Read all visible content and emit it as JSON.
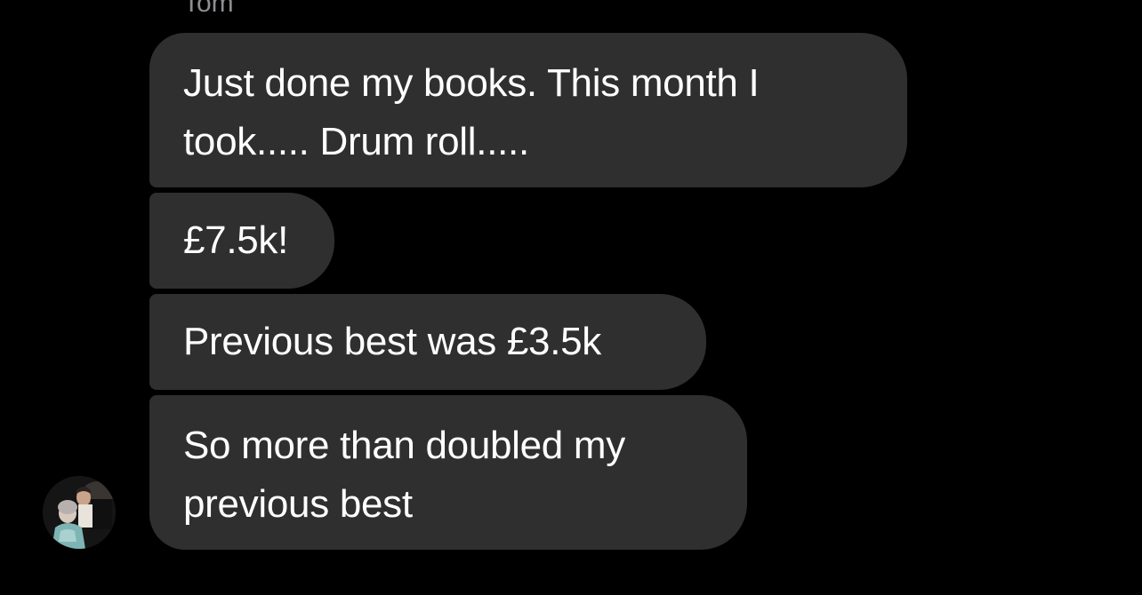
{
  "conversation": {
    "sender_name": "Tom",
    "messages": [
      {
        "lines": [
          "Just done my books. This month I",
          "took..... Drum roll....."
        ]
      },
      {
        "lines": [
          "£7.5k!"
        ]
      },
      {
        "lines": [
          "Previous best was £3.5k"
        ]
      },
      {
        "lines": [
          "So more than doubled my",
          "previous best"
        ]
      }
    ]
  },
  "colors": {
    "background": "#000000",
    "bubble": "#2f2f2f",
    "text": "#ffffff",
    "sender_name": "#8e8e93"
  },
  "icons": {
    "avatar": "sender-avatar-photo"
  }
}
